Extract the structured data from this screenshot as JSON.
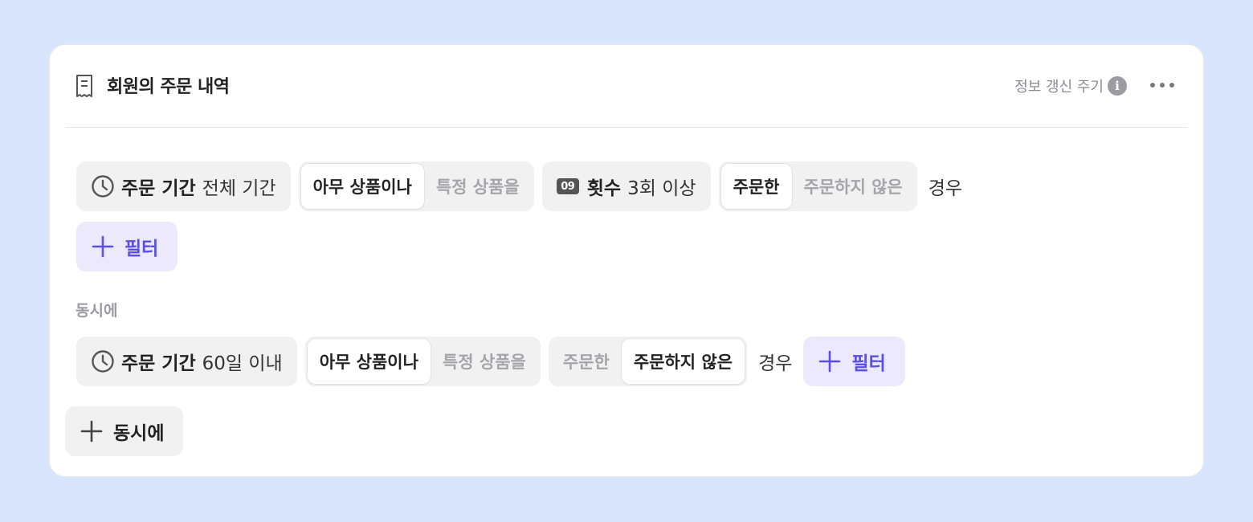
{
  "card": {
    "title": "회원의 주문 내역",
    "icons": {
      "title": "receipt-icon",
      "info": "info-icon",
      "more": "more-icon"
    },
    "refresh_label": "정보 갱신 주기",
    "info_glyph": "i"
  },
  "group1": {
    "period": {
      "key": "주문 기간",
      "value": "전체 기간"
    },
    "product_seg": {
      "options": [
        "아무 상품이나",
        "특정 상품을"
      ],
      "selected": "아무 상품이나"
    },
    "count": {
      "badge": "09",
      "key": "횟수",
      "value": "3회 이상"
    },
    "order_seg": {
      "options": [
        "주문한",
        "주문하지 않은"
      ],
      "selected": "주문한"
    },
    "suffix": "경우",
    "add_filter": "필터"
  },
  "and_label": "동시에",
  "group2": {
    "period": {
      "key": "주문 기간",
      "value": "60일 이내"
    },
    "product_seg": {
      "options": [
        "아무 상품이나",
        "특정 상품을"
      ],
      "selected": "아무 상품이나"
    },
    "order_seg": {
      "options": [
        "주문한",
        "주문하지 않은"
      ],
      "selected": "주문하지 않은"
    },
    "suffix": "경우",
    "add_filter": "필터"
  },
  "add_and_button": "동시에",
  "colors": {
    "page_bg": "#d9e5fd",
    "card_bg": "#ffffff",
    "chip_bg": "#f1f1f1",
    "accent": "#5b4ee8",
    "accent_bg": "#ece9fd",
    "muted_text": "#a3a5aa"
  }
}
